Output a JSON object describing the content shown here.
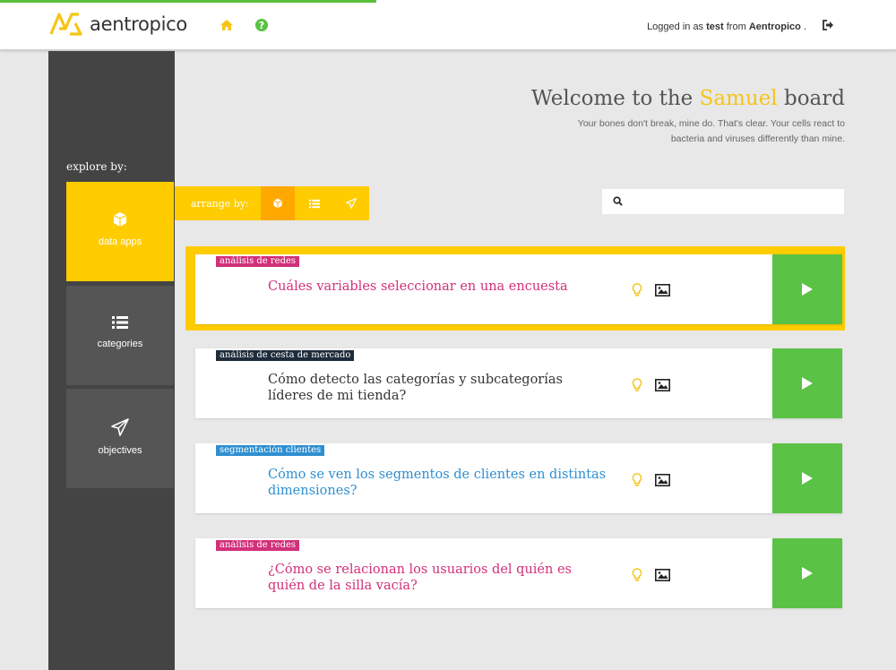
{
  "header": {
    "logo_text": "aentropico",
    "login_prefix": "Logged in as",
    "login_user": "test",
    "login_from": "from",
    "login_org": "Aentropico",
    "login_suffix": "."
  },
  "sidebar": {
    "explore_label": "explore by:",
    "items": [
      {
        "label": "data apps",
        "icon": "cube-icon",
        "active": true
      },
      {
        "label": "categories",
        "icon": "list-icon",
        "active": false
      },
      {
        "label": "objectives",
        "icon": "paper-plane-icon",
        "active": false
      }
    ]
  },
  "arrange": {
    "label": "arrange by:",
    "options": [
      "cube-icon",
      "list-icon",
      "paper-plane-icon"
    ]
  },
  "welcome": {
    "prefix": "Welcome to the",
    "name": "Samuel",
    "suffix": "board",
    "subtitle": "Your bones don't break, mine do. That's clear. Your cells react to bacteria and viruses differently than mine."
  },
  "search": {
    "placeholder": "",
    "value": ""
  },
  "cards": [
    {
      "tag": "análisis de redes",
      "tag_color": "#d2307a",
      "title": "Cuáles variables seleccionar en una encuesta",
      "title_color": "#d2307a"
    },
    {
      "tag": "análisis de cesta de mercado",
      "tag_color": "#1d2b3a",
      "title": "Cómo detecto las categorías y subcategorías líderes de mi tienda?",
      "title_color": "#333333"
    },
    {
      "tag": "segmentación clientes",
      "tag_color": "#2e8fd0",
      "title": "Cómo se ven los segmentos de clientes en distintas dimensiones?",
      "title_color": "#2e8fd0"
    },
    {
      "tag": "análisis de redes",
      "tag_color": "#d2307a",
      "title": "¿Cómo se relacionan los usuarios del quién es quién de la silla vacía?",
      "title_color": "#d2307a"
    }
  ],
  "colors": {
    "accent": "#ffcc00",
    "play": "#5ac244",
    "sidebar": "#444444"
  }
}
